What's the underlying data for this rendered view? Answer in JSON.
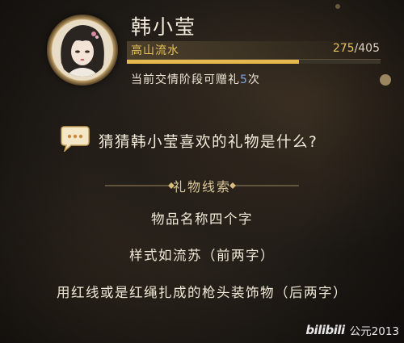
{
  "character": {
    "name": "韩小莹",
    "rank": "高山流水",
    "affinity_current": "275",
    "affinity_separator": "/",
    "affinity_max": "405",
    "affinity_progress": 0.679,
    "gift_text_prefix": "当前交情阶段可赠礼",
    "gift_count": "5",
    "gift_text_suffix": "次"
  },
  "question": {
    "icon": "chat-bubble-icon",
    "text": "猜猜韩小莹喜欢的礼物是什么?"
  },
  "clues": {
    "title": "礼物线索",
    "items": [
      "物品名称四个字",
      "样式如流苏（前两字）",
      "用红线或是红绳扎成的枪头装饰物（后两字）"
    ]
  },
  "watermark": {
    "platform": "bilibili",
    "user": "公元2013"
  },
  "colors": {
    "gold": "#e6c15e",
    "number_blue": "#7aa8e8",
    "text": "#efe6d6"
  }
}
